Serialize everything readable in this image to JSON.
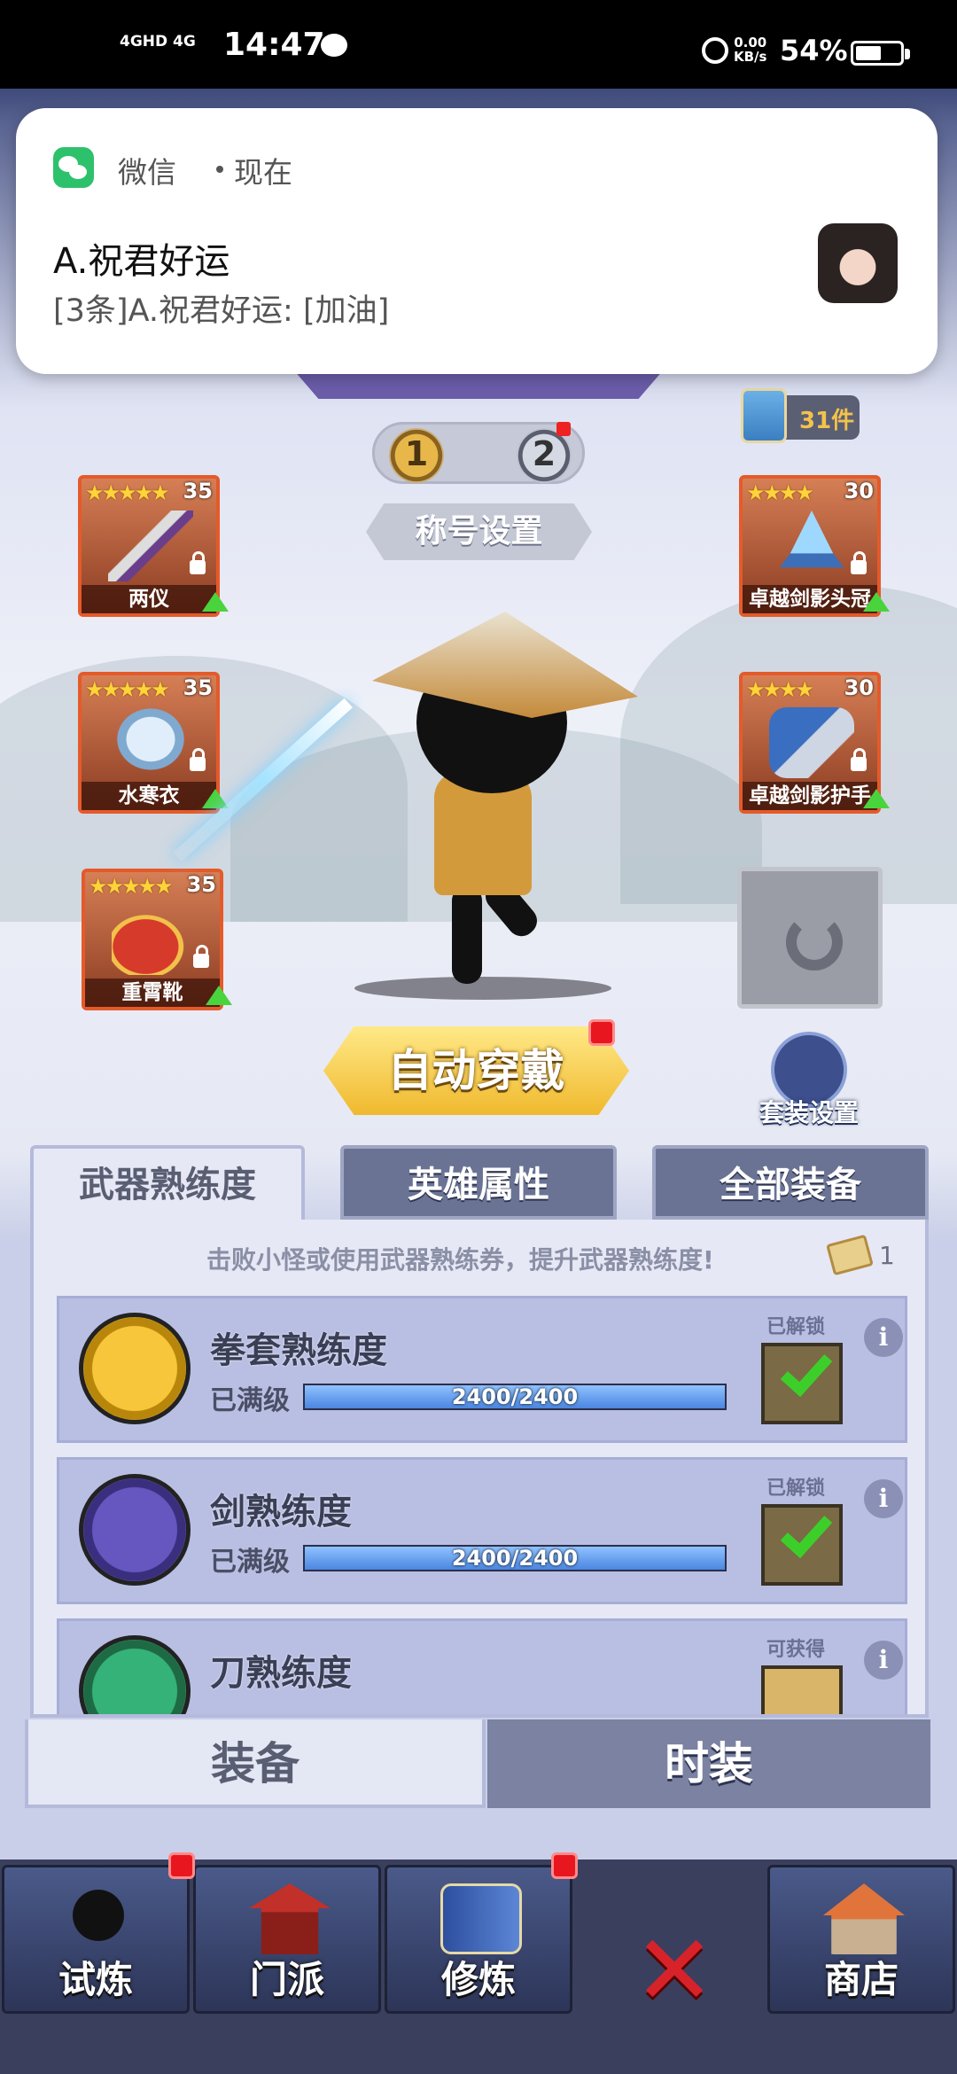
{
  "status_bar": {
    "network": "4GHD 4G",
    "time": "14:47",
    "net_speed": "0.00\nKB/s",
    "battery": "54%"
  },
  "notification": {
    "app": "微信",
    "time": "现在",
    "title": "A.祝君好运",
    "body": "[3条]A.祝君好运: [加油]"
  },
  "title_switch": {
    "one": "1",
    "two": "2"
  },
  "title_settings": "称号设置",
  "items_count": "31件",
  "slots": [
    {
      "stars": "★★★★★",
      "level": "35",
      "name": "两仪"
    },
    {
      "stars": "★★★★★",
      "level": "35",
      "name": "水寒衣"
    },
    {
      "stars": "★★★★★",
      "level": "35",
      "name": "重霄靴"
    },
    {
      "stars": "★★★★",
      "level": "30",
      "name": "卓越剑影头冠"
    },
    {
      "stars": "★★★★",
      "level": "30",
      "name": "卓越剑影护手"
    }
  ],
  "auto_equip": "自动穿戴",
  "set_settings": "套装设置",
  "tabs": [
    "武器熟练度",
    "英雄属性",
    "全部装备"
  ],
  "panel": {
    "tip": "击败小怪或使用武器熟练券，提升武器熟练度!",
    "ticket_count": "1",
    "rows": [
      {
        "name": "拳套熟练度",
        "status": "已满级",
        "progress": "2400/2400",
        "fill": 1.0,
        "unlock": "已解锁"
      },
      {
        "name": "剑熟练度",
        "status": "已满级",
        "progress": "2400/2400",
        "fill": 1.0,
        "unlock": "已解锁"
      },
      {
        "name": "刀熟练度",
        "status": "",
        "progress": "",
        "fill": 0,
        "unlock": "可获得"
      }
    ]
  },
  "bottom_tabs": {
    "equip": "装备",
    "fashion": "时装"
  },
  "nav": [
    "试炼",
    "门派",
    "修炼",
    "商店"
  ],
  "colors": {
    "accent_gold": "#f0b92e",
    "badge_red": "#e8161e",
    "check_green": "#3ccf2a"
  }
}
